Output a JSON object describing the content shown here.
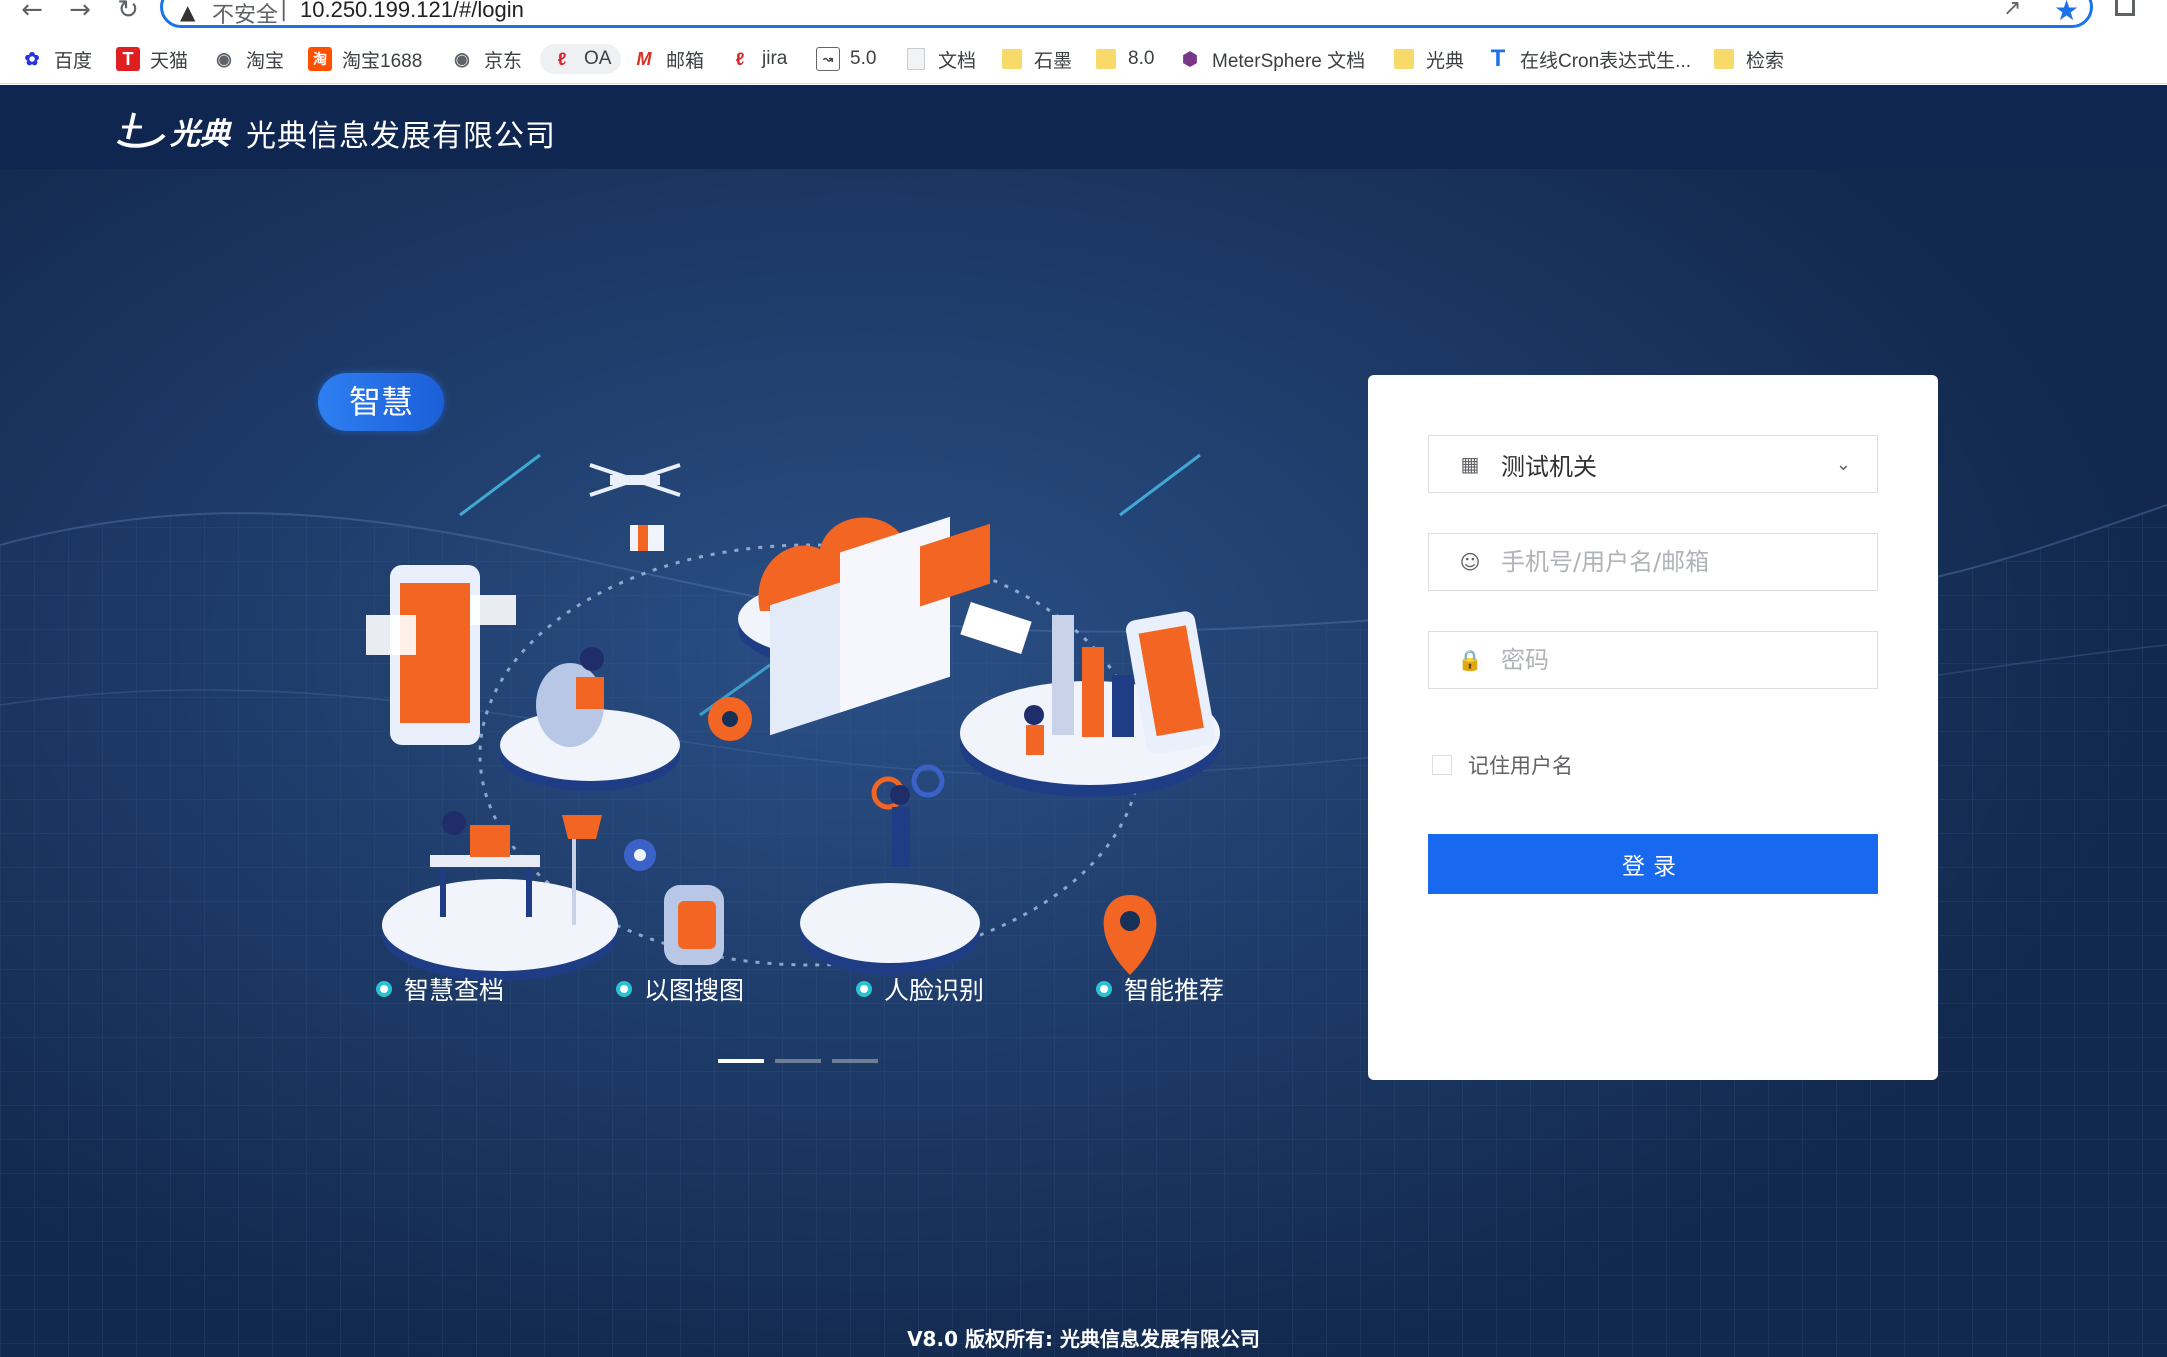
{
  "browser": {
    "back_icon": "arrow-left-icon",
    "forward_icon": "arrow-right-icon",
    "reload_icon": "reload-icon",
    "insecure_label": "不安全",
    "separator": "|",
    "url": "10.250.199.121/#/login",
    "bookmarks": [
      {
        "label": "百度",
        "icon": "baidu-paw-icon",
        "color": "#2932e1"
      },
      {
        "label": "天猫",
        "icon": "tmall-icon",
        "color": "#e02020"
      },
      {
        "label": "淘宝",
        "icon": "globe-icon",
        "color": "#5f6368"
      },
      {
        "label": "淘宝1688",
        "icon": "taobao-icon",
        "color": "#ff5000"
      },
      {
        "label": "京东",
        "icon": "globe-icon",
        "color": "#5f6368"
      },
      {
        "label": "OA",
        "icon": "oa-logo-icon",
        "color": "#d7262b"
      },
      {
        "label": "邮箱",
        "icon": "mail-m-icon",
        "color": "#d93025"
      },
      {
        "label": "jira",
        "icon": "jira-logo-icon",
        "color": "#d7262b"
      },
      {
        "label": "5.0",
        "icon": "chart-icon",
        "color": "#333333"
      },
      {
        "label": "文档",
        "icon": "document-icon",
        "color": "#cccccc"
      },
      {
        "label": "石墨",
        "icon": "folder-icon",
        "color": "#f9d96a"
      },
      {
        "label": "8.0",
        "icon": "folder-icon",
        "color": "#f9d96a"
      },
      {
        "label": "MeterSphere 文档",
        "icon": "metersphere-icon",
        "color": "#783887"
      },
      {
        "label": "光典",
        "icon": "folder-icon",
        "color": "#f9d96a"
      },
      {
        "label": "在线Cron表达式生...",
        "icon": "t-logo-icon",
        "color": "#1a73e8"
      },
      {
        "label": "检索",
        "icon": "folder-icon",
        "color": "#f9d96a"
      }
    ]
  },
  "header": {
    "logo_brand": "光典",
    "company_name": "光典信息发展有限公司"
  },
  "hero": {
    "pill_label": "智慧",
    "features": [
      "智慧查档",
      "以图搜图",
      "人脸识别",
      "智能推荐"
    ],
    "carousel_active_index": 0,
    "carousel_count": 3
  },
  "login": {
    "org_icon": "building-icon",
    "org_value": "测试机关",
    "chevron_icon": "chevron-down-icon",
    "username_icon": "user-icon",
    "username_placeholder": "手机号/用户名/邮箱",
    "password_icon": "lock-icon",
    "password_placeholder": "密码",
    "remember_label": "记住用户名",
    "remember_checked": false,
    "submit_label": "登录"
  },
  "footer": {
    "copyright": "V8.0 版权所有: 光典信息发展有限公司"
  },
  "colors": {
    "header_bg": "#0f2650",
    "page_bg": "#173058",
    "primary": "#1868f0",
    "accent_orange": "#f26522",
    "feature_dot": "#29c2d2"
  }
}
